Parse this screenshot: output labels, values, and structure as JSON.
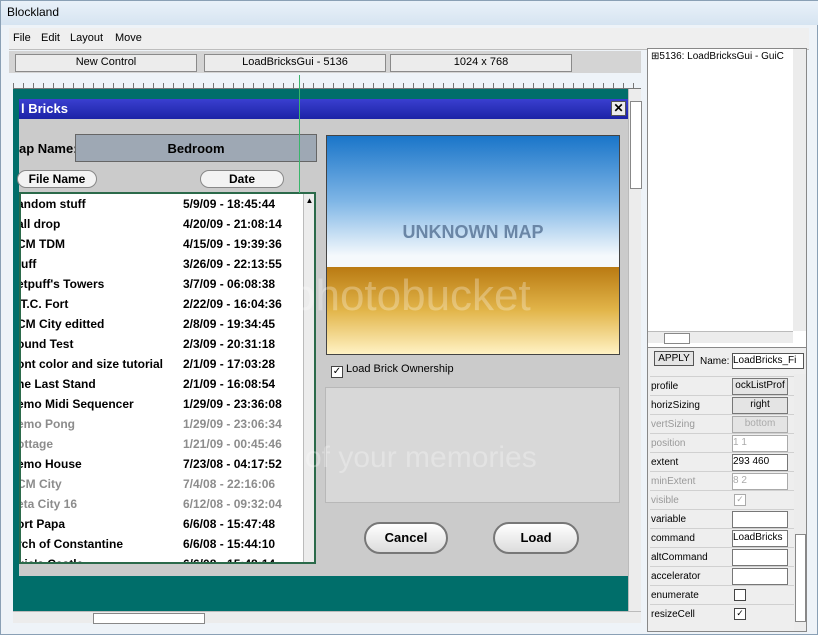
{
  "window": {
    "title": "Blockland"
  },
  "menu": [
    "File",
    "Edit",
    "Layout",
    "Move"
  ],
  "toolbar": {
    "new_control": "New Control",
    "gui_name": "LoadBricksGui - 5136",
    "resolution": "1024 x 768"
  },
  "dialog": {
    "title": "l Bricks",
    "close_glyph": "✕",
    "map_label": "ap Name:",
    "map_value": "Bedroom",
    "col_file": "File Name",
    "col_date": "Date",
    "files": [
      {
        "name": "andom stuff",
        "date": "5/9/09 - 18:45:44",
        "dim": false
      },
      {
        "name": "all drop",
        "date": "4/20/09 - 21:08:14",
        "dim": false
      },
      {
        "name": "CM TDM",
        "date": "4/15/09 - 19:39:36",
        "dim": false
      },
      {
        "name": "tuff",
        "date": "3/26/09 - 22:13:55",
        "dim": false
      },
      {
        "name": "etpuff's Towers",
        "date": "3/7/09 - 06:08:38",
        "dim": false
      },
      {
        "name": ".T.C. Fort",
        "date": "2/22/09 - 16:04:36",
        "dim": false
      },
      {
        "name": "CM City editted",
        "date": "2/8/09 - 19:34:45",
        "dim": false
      },
      {
        "name": "ound Test",
        "date": "2/3/09 - 20:31:18",
        "dim": false
      },
      {
        "name": "ont color and size tutorial",
        "date": "2/1/09 - 17:03:28",
        "dim": false
      },
      {
        "name": "he Last Stand",
        "date": "2/1/09 - 16:08:54",
        "dim": false
      },
      {
        "name": "emo Midi Sequencer",
        "date": "1/29/09 - 23:36:08",
        "dim": false
      },
      {
        "name": "emo Pong",
        "date": "1/29/09 - 23:06:34",
        "dim": true
      },
      {
        "name": "ottage",
        "date": "1/21/09 - 00:45:46",
        "dim": true
      },
      {
        "name": "emo House",
        "date": "7/23/08 - 04:17:52",
        "dim": false
      },
      {
        "name": "CM City",
        "date": "7/4/08 - 22:16:06",
        "dim": true
      },
      {
        "name": "eta City 16",
        "date": "6/12/08 - 09:32:04",
        "dim": true
      },
      {
        "name": "ort Papa",
        "date": "6/6/08 - 15:47:48",
        "dim": false
      },
      {
        "name": "rch of Constantine",
        "date": "6/6/08 - 15:44:10",
        "dim": false
      },
      {
        "name": "gic's Castle",
        "date": "6/6/08 - 15:48:14",
        "dim": false
      }
    ],
    "preview_text": "UNKNOWN MAP",
    "ownership_label": "Load Brick Ownership",
    "ownership_check": "✓",
    "cancel": "Cancel",
    "load": "Load"
  },
  "tree": {
    "item": "⊞5136: LoadBricksGui - GuiC"
  },
  "inspector": {
    "apply": "APPLY",
    "name_label": "Name:",
    "name_value": "LoadBricks_Fi",
    "props": [
      {
        "key": "profile",
        "value": "ockListProf",
        "kind": "grey"
      },
      {
        "key": "horizSizing",
        "value": "right",
        "kind": "grey"
      },
      {
        "key": "vertSizing",
        "value": "bottom",
        "kind": "grey-dis"
      },
      {
        "key": "position",
        "value": "1 1",
        "kind": "dis"
      },
      {
        "key": "extent",
        "value": "293 460",
        "kind": "text"
      },
      {
        "key": "minExtent",
        "value": "8 2",
        "kind": "dis"
      },
      {
        "key": "visible",
        "value": "✓",
        "kind": "check-dis"
      },
      {
        "key": "variable",
        "value": "",
        "kind": "text"
      },
      {
        "key": "command",
        "value": "LoadBricks",
        "kind": "text"
      },
      {
        "key": "altCommand",
        "value": "",
        "kind": "text"
      },
      {
        "key": "accelerator",
        "value": "",
        "kind": "text"
      },
      {
        "key": "enumerate",
        "value": "",
        "kind": "check"
      },
      {
        "key": "resizeCell",
        "value": "✓",
        "kind": "check"
      }
    ]
  },
  "watermark": {
    "line1": "photobucket",
    "line2": "of your memories"
  }
}
